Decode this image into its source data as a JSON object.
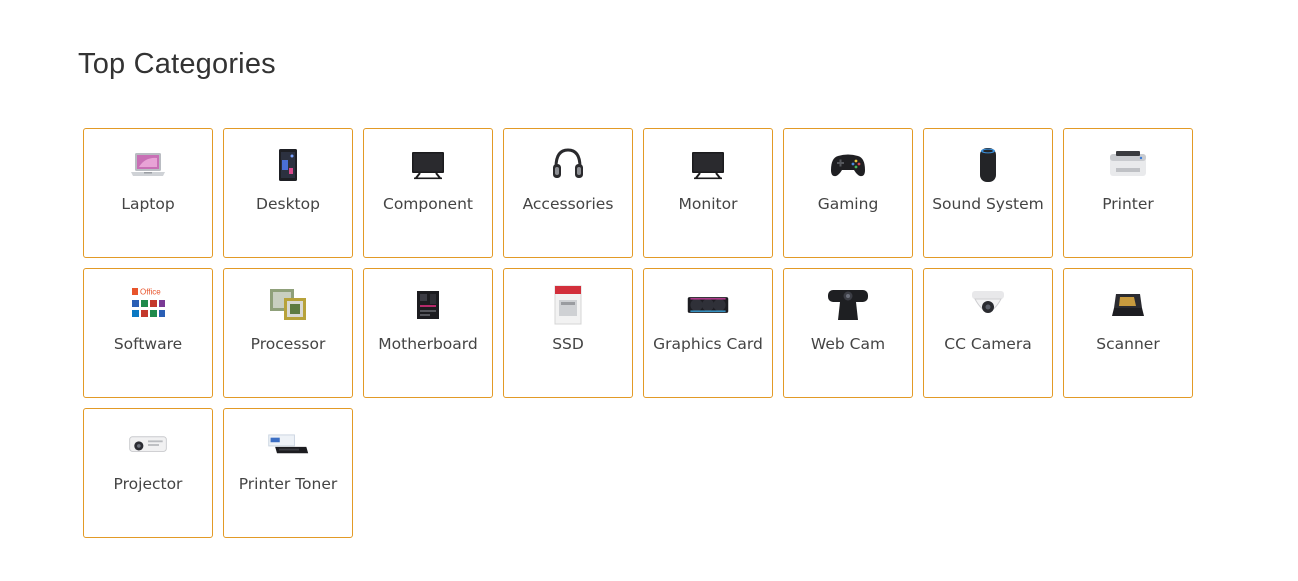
{
  "section": {
    "title": "Top Categories"
  },
  "categories": [
    {
      "label": "Laptop",
      "icon": "laptop-icon"
    },
    {
      "label": "Desktop",
      "icon": "desktop-tower-icon"
    },
    {
      "label": "Component",
      "icon": "monitor-screen-icon"
    },
    {
      "label": "Accessories",
      "icon": "headphones-icon"
    },
    {
      "label": "Monitor",
      "icon": "monitor-icon"
    },
    {
      "label": "Gaming",
      "icon": "gamepad-icon"
    },
    {
      "label": "Sound System",
      "icon": "smart-speaker-icon"
    },
    {
      "label": "Printer",
      "icon": "printer-icon"
    },
    {
      "label": "Software",
      "icon": "office-suite-icon"
    },
    {
      "label": "Processor",
      "icon": "cpu-chip-icon"
    },
    {
      "label": "Motherboard",
      "icon": "motherboard-icon"
    },
    {
      "label": "SSD",
      "icon": "ssd-icon"
    },
    {
      "label": "Graphics Card",
      "icon": "graphics-card-icon"
    },
    {
      "label": "Web Cam",
      "icon": "webcam-icon"
    },
    {
      "label": "CC Camera",
      "icon": "dome-camera-icon"
    },
    {
      "label": "Scanner",
      "icon": "scanner-icon"
    },
    {
      "label": "Projector",
      "icon": "projector-icon"
    },
    {
      "label": "Printer Toner",
      "icon": "toner-cartridge-icon"
    }
  ],
  "colors": {
    "card_border": "#e29a26",
    "title_text": "#333333",
    "label_text": "#444444"
  },
  "software_icon_text": "Office"
}
